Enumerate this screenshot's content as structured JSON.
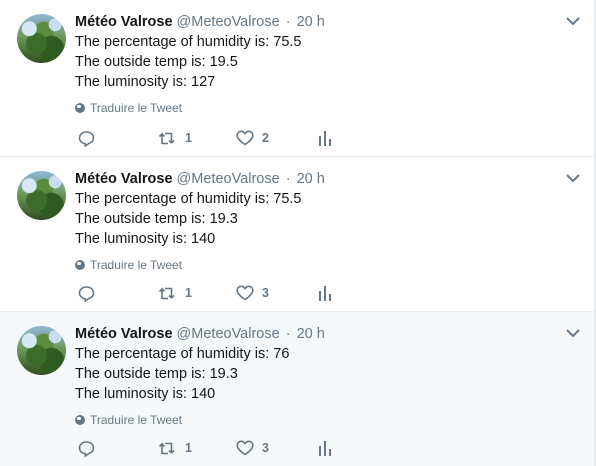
{
  "tweets": [
    {
      "name": "Météo Valrose",
      "handle": "@MeteoValrose",
      "separator": "·",
      "time": "20 h",
      "lines": [
        "The percentage of humidity is: 75.5",
        "The outside temp is: 19.5",
        "The luminosity is: 127"
      ],
      "translate": "Traduire le Tweet",
      "retweets": "1",
      "likes": "2"
    },
    {
      "name": "Météo Valrose",
      "handle": "@MeteoValrose",
      "separator": "·",
      "time": "20 h",
      "lines": [
        "The percentage of humidity is: 75.5",
        "The outside temp is: 19.3",
        "The luminosity is: 140"
      ],
      "translate": "Traduire le Tweet",
      "retweets": "1",
      "likes": "3"
    },
    {
      "name": "Météo Valrose",
      "handle": "@MeteoValrose",
      "separator": "·",
      "time": "20 h",
      "lines": [
        "The percentage of humidity is: 76",
        "The outside temp is: 19.3",
        "The luminosity is: 140"
      ],
      "translate": "Traduire le Tweet",
      "retweets": "1",
      "likes": "3"
    }
  ],
  "icons": {
    "reply": "reply-icon",
    "retweet": "retweet-icon",
    "like": "heart-icon",
    "analytics": "analytics-icon",
    "caret": "chevron-down-icon",
    "globe": "globe-icon"
  },
  "colors": {
    "secondary_text": "#657786",
    "highlight_background": "#f5f8fa",
    "divider": "#e6ecf0"
  }
}
